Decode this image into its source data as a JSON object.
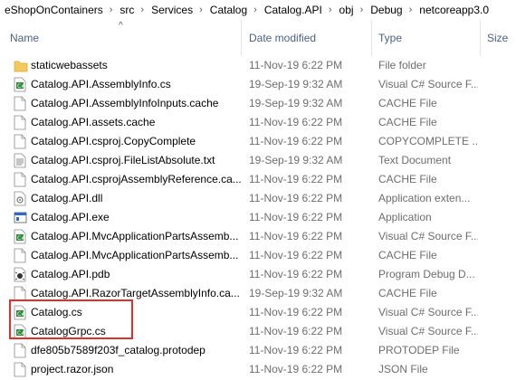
{
  "breadcrumb": [
    "eShopOnContainers",
    "src",
    "Services",
    "Catalog",
    "Catalog.API",
    "obj",
    "Debug",
    "netcoreapp3.0"
  ],
  "columns": {
    "name": "Name",
    "date": "Date modified",
    "type": "Type",
    "size": "Size"
  },
  "files": [
    {
      "name": "staticwebassets",
      "date": "11-Nov-19 6:22 PM",
      "type": "File folder",
      "icon": "folder-icon"
    },
    {
      "name": "Catalog.API.AssemblyInfo.cs",
      "date": "19-Sep-19 9:32 AM",
      "type": "Visual C# Source F...",
      "icon": "csharp-file-icon"
    },
    {
      "name": "Catalog.API.AssemblyInfoInputs.cache",
      "date": "19-Sep-19 9:32 AM",
      "type": "CACHE File",
      "icon": "blank-file-icon"
    },
    {
      "name": "Catalog.API.assets.cache",
      "date": "11-Nov-19 6:22 PM",
      "type": "CACHE File",
      "icon": "blank-file-icon"
    },
    {
      "name": "Catalog.API.csproj.CopyComplete",
      "date": "11-Nov-19 6:22 PM",
      "type": "COPYCOMPLETE ...",
      "icon": "blank-file-icon"
    },
    {
      "name": "Catalog.API.csproj.FileListAbsolute.txt",
      "date": "19-Sep-19 9:32 AM",
      "type": "Text Document",
      "icon": "text-file-icon"
    },
    {
      "name": "Catalog.API.csprojAssemblyReference.ca...",
      "date": "11-Nov-19 6:22 PM",
      "type": "CACHE File",
      "icon": "blank-file-icon"
    },
    {
      "name": "Catalog.API.dll",
      "date": "11-Nov-19 6:22 PM",
      "type": "Application exten...",
      "icon": "dll-file-icon"
    },
    {
      "name": "Catalog.API.exe",
      "date": "11-Nov-19 6:22 PM",
      "type": "Application",
      "icon": "exe-file-icon"
    },
    {
      "name": "Catalog.API.MvcApplicationPartsAssemb...",
      "date": "11-Nov-19 6:22 PM",
      "type": "Visual C# Source F...",
      "icon": "csharp-file-icon"
    },
    {
      "name": "Catalog.API.MvcApplicationPartsAssemb...",
      "date": "11-Nov-19 6:22 PM",
      "type": "CACHE File",
      "icon": "blank-file-icon"
    },
    {
      "name": "Catalog.API.pdb",
      "date": "11-Nov-19 6:22 PM",
      "type": "Program Debug D...",
      "icon": "pdb-file-icon"
    },
    {
      "name": "Catalog.API.RazorTargetAssemblyInfo.ca...",
      "date": "19-Sep-19 9:32 AM",
      "type": "CACHE File",
      "icon": "blank-file-icon"
    },
    {
      "name": "Catalog.cs",
      "date": "11-Nov-19 6:22 PM",
      "type": "Visual C# Source F...",
      "icon": "csharp-file-icon"
    },
    {
      "name": "CatalogGrpc.cs",
      "date": "11-Nov-19 6:22 PM",
      "type": "Visual C# Source F...",
      "icon": "csharp-file-icon"
    },
    {
      "name": "dfe805b7589f203f_catalog.protodep",
      "date": "11-Nov-19 6:22 PM",
      "type": "PROTODEP File",
      "icon": "blank-file-icon"
    },
    {
      "name": "project.razor.json",
      "date": "11-Nov-19 6:22 PM",
      "type": "JSON File",
      "icon": "blank-file-icon"
    }
  ],
  "colors": {
    "highlight": "#e0302a",
    "header_text": "#4d6082",
    "folder": "#f4c95d",
    "csharp": "#2e8b3a"
  }
}
